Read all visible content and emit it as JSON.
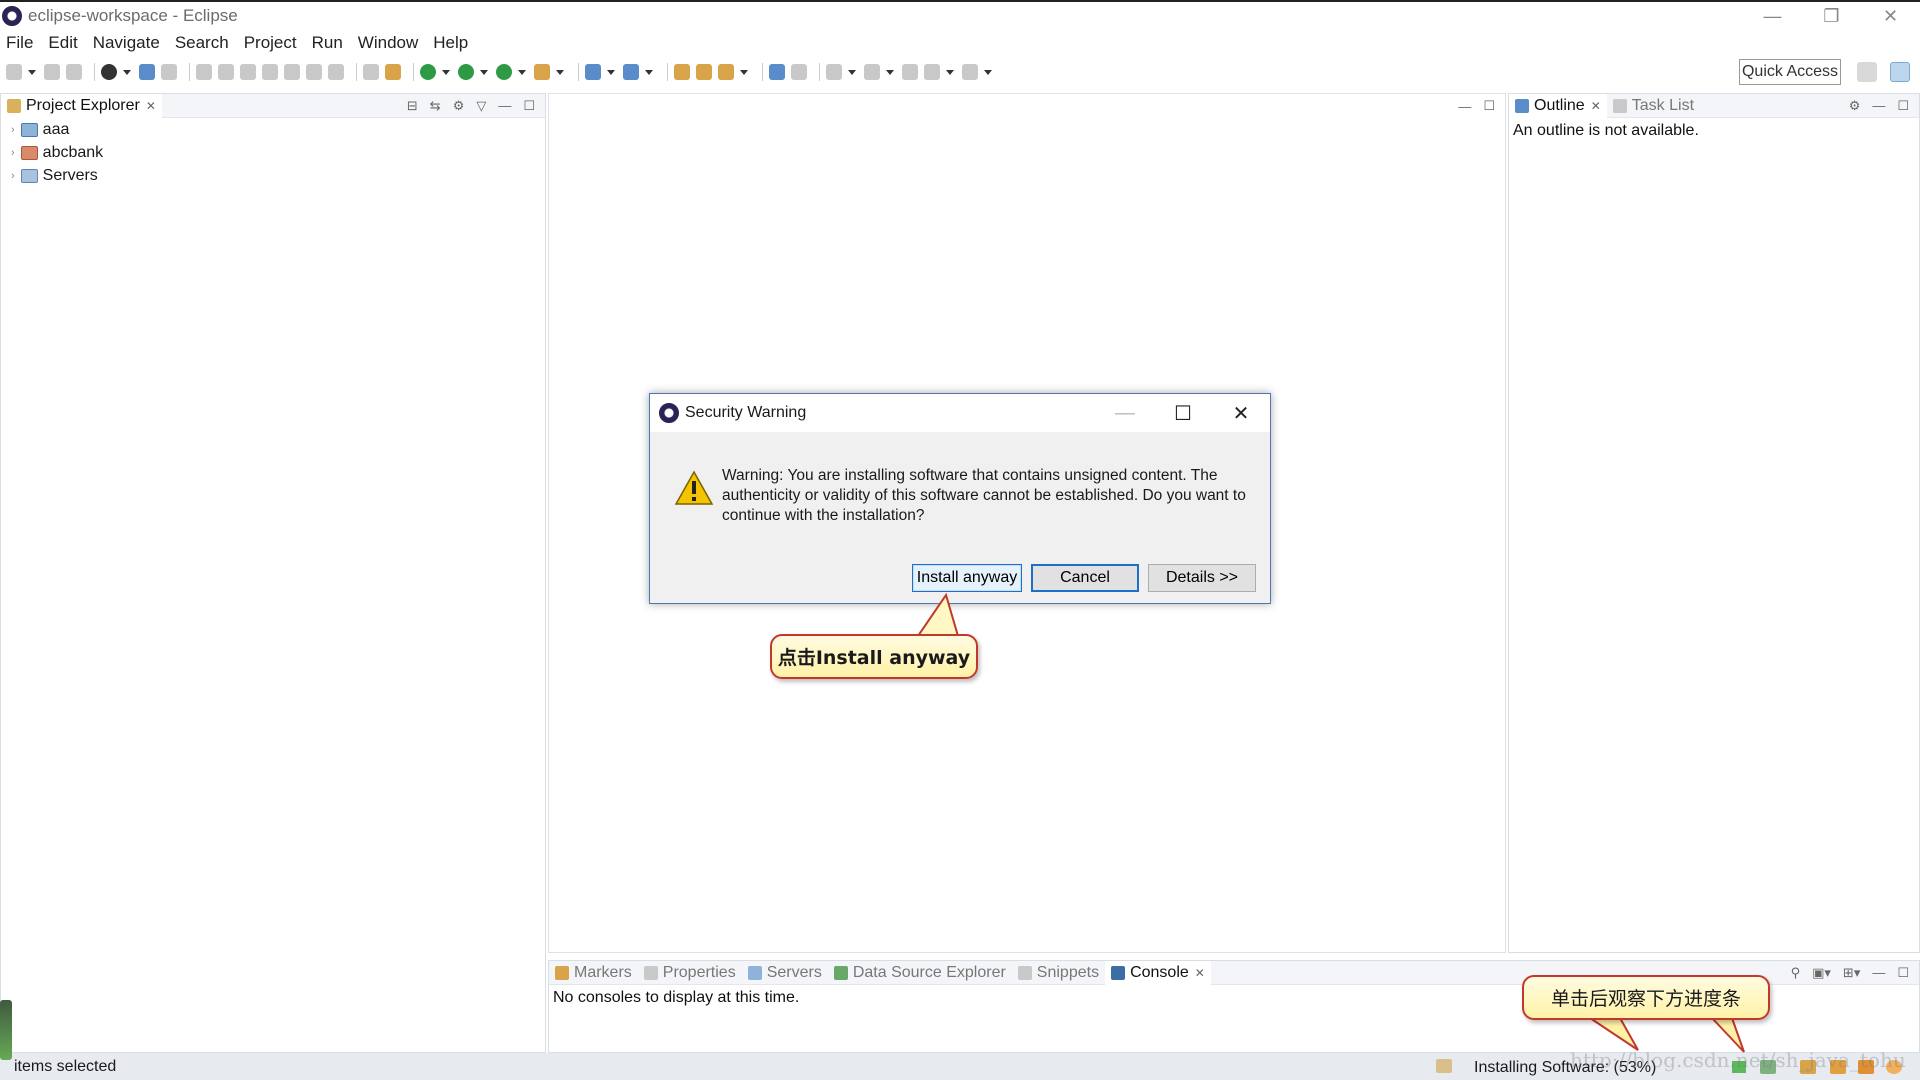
{
  "window": {
    "title": "eclipse-workspace - Eclipse",
    "minimize_glyph": "—",
    "restore_glyph": "❐",
    "close_glyph": "✕"
  },
  "menu": [
    "File",
    "Edit",
    "Navigate",
    "Search",
    "Project",
    "Run",
    "Window",
    "Help"
  ],
  "toolbar": {
    "quick_access": "Quick Access"
  },
  "project_explorer": {
    "tab_label": "Project Explorer",
    "items": [
      {
        "label": "aaa",
        "icon": "java-project-icon"
      },
      {
        "label": "abcbank",
        "icon": "web-project-icon"
      },
      {
        "label": "Servers",
        "icon": "folder-icon"
      }
    ]
  },
  "outline": {
    "tabs": [
      "Outline",
      "Task List"
    ],
    "message": "An outline is not available."
  },
  "console": {
    "tabs": [
      "Markers",
      "Properties",
      "Servers",
      "Data Source Explorer",
      "Snippets",
      "Console"
    ],
    "message": "No consoles to display at this time."
  },
  "status": {
    "left": "items selected",
    "right": "Installing Software: (53%)"
  },
  "dialog": {
    "title": "Security Warning",
    "message": "Warning: You are installing software that contains unsigned content. The authenticity or validity of this software cannot be established. Do you want to continue with the installation?",
    "buttons": {
      "install": "Install anyway",
      "cancel": "Cancel",
      "details": "Details >>"
    },
    "minimize_glyph": "—",
    "maximize_glyph": "☐",
    "close_glyph": "✕"
  },
  "annotations": {
    "install_callout": "点击Install anyway",
    "progress_callout": "单击后观察下方进度条"
  },
  "watermark": "http://blog.csdn.net/sh_java_tohu"
}
